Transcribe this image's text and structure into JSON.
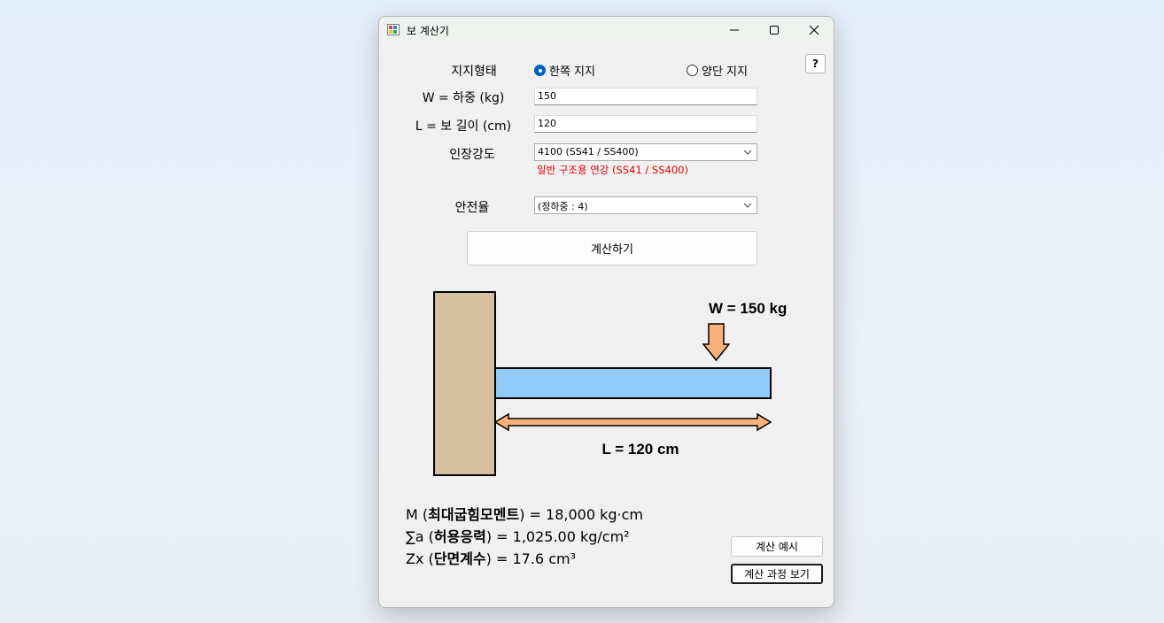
{
  "window": {
    "title": "보 계산기"
  },
  "form": {
    "support_label": "지지형태",
    "support_options": [
      {
        "label": "한쪽 지지",
        "selected": true
      },
      {
        "label": "양단 지지",
        "selected": false
      }
    ],
    "help_label": "?",
    "load_label": "W = 하중 (kg)",
    "load_value": "150",
    "length_label": "L = 보 길이 (cm)",
    "length_value": "120",
    "strength_label": "인장강도",
    "strength_value": "4100 (SS41 / SS400)",
    "strength_note": "일반 구조용 연강 (SS41 / SS400)",
    "safety_label": "안전율",
    "safety_value": "(정하중 : 4)",
    "calculate_label": "계산하기"
  },
  "diagram": {
    "load_text": "W = 150 kg",
    "length_text": "L = 120 cm",
    "wall_color": "#d4bf9f",
    "beam_color": "#90cbfa",
    "arrow_color": "#f8b17a"
  },
  "results": {
    "moment_prefix": "M (",
    "moment_term": "최대굽힘모멘트",
    "moment_suffix": ") = 18,000 kg·cm",
    "stress_prefix": "∑a (",
    "stress_term": "허용응력",
    "stress_suffix": ") = 1,025.00 kg/cm²",
    "modulus_prefix": "Zx (",
    "modulus_term": "단면계수",
    "modulus_suffix": ") = 17.6 cm³"
  },
  "buttons": {
    "example_label": "계산 예시",
    "process_label": "계산 과정 보기"
  },
  "colors": {
    "accent": "#005fb8",
    "note_red": "#e00000"
  }
}
